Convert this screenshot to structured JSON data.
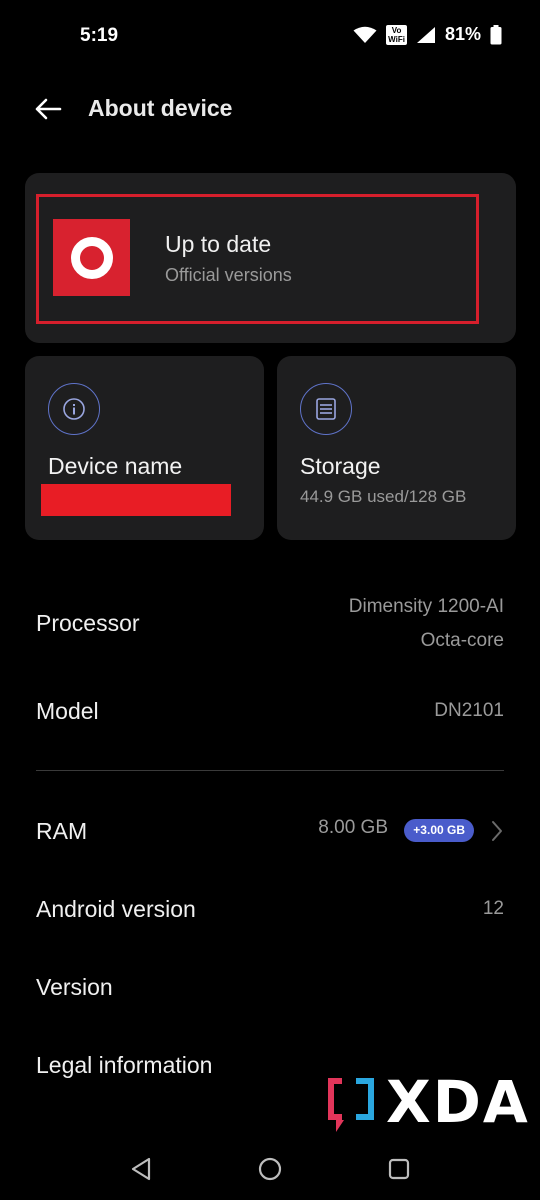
{
  "status_bar": {
    "time": "5:19",
    "vowifi_top": "Vo",
    "vowifi_bottom": "WiFi",
    "battery": "81%"
  },
  "header": {
    "title": "About device",
    "back_icon": "arrow-left-icon"
  },
  "update_card": {
    "title": "Up to date",
    "subtitle": "Official versions",
    "logo_color": "#d8222f"
  },
  "device_card": {
    "title": "Device name",
    "icon": "info-icon"
  },
  "storage_card": {
    "title": "Storage",
    "subtitle": "44.9 GB used/128 GB",
    "icon": "storage-icon"
  },
  "specs": {
    "processor": {
      "label": "Processor",
      "value_line1": "Dimensity 1200-AI",
      "value_line2": "Octa-core"
    },
    "model": {
      "label": "Model",
      "value": "DN2101"
    },
    "ram": {
      "label": "RAM",
      "value": "8.00 GB",
      "badge": "+3.00 GB"
    },
    "android": {
      "label": "Android version",
      "value": "12"
    },
    "version": {
      "label": "Version"
    },
    "legal": {
      "label": "Legal information"
    }
  },
  "watermark": {
    "text": "XDA"
  },
  "colors": {
    "accent_red": "#d61f2c",
    "badge_blue": "#4a5ccb",
    "icon_ring": "#5f73c9",
    "card_bg": "#1e1e1f"
  }
}
